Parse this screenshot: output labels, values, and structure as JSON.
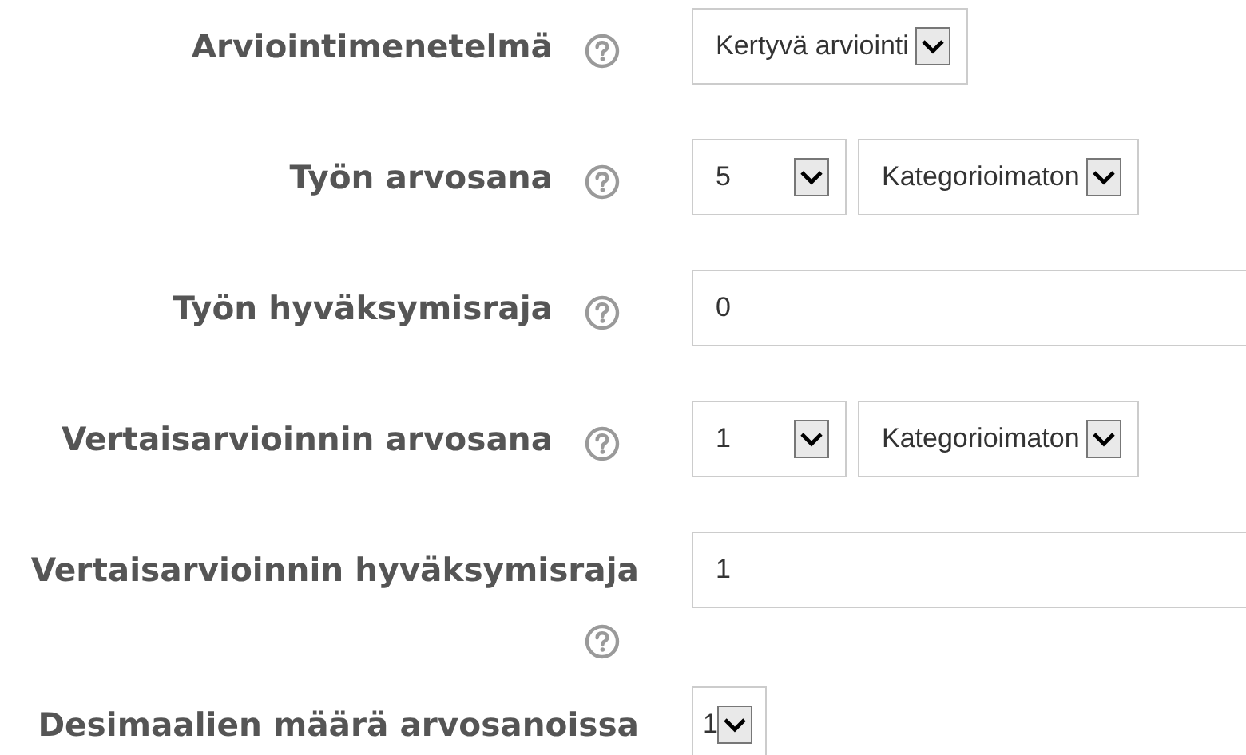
{
  "rows": [
    {
      "label": "Arviointimenetelmä",
      "help": true,
      "controls": [
        {
          "kind": "select",
          "value": "Kertyvä arviointi"
        }
      ]
    },
    {
      "label": "Työn arvosana",
      "help": true,
      "controls": [
        {
          "kind": "number-select",
          "value": "5"
        },
        {
          "kind": "select",
          "value": "Kategorioimaton"
        }
      ]
    },
    {
      "label": "Työn hyväksymisraja",
      "help": true,
      "controls": [
        {
          "kind": "text",
          "value": "0"
        }
      ]
    },
    {
      "label": "Vertaisarvioinnin arvosana",
      "help": true,
      "controls": [
        {
          "kind": "number-select",
          "value": "1"
        },
        {
          "kind": "select",
          "value": "Kategorioimaton"
        }
      ]
    },
    {
      "label": "Vertaisarvioinnin hyväksymisraja",
      "help": true,
      "controls": [
        {
          "kind": "text",
          "value": "1"
        }
      ]
    },
    {
      "label": "Desimaalien määrä arvosanoissa",
      "help": false,
      "controls": [
        {
          "kind": "compact-select",
          "value": "1"
        }
      ]
    }
  ]
}
